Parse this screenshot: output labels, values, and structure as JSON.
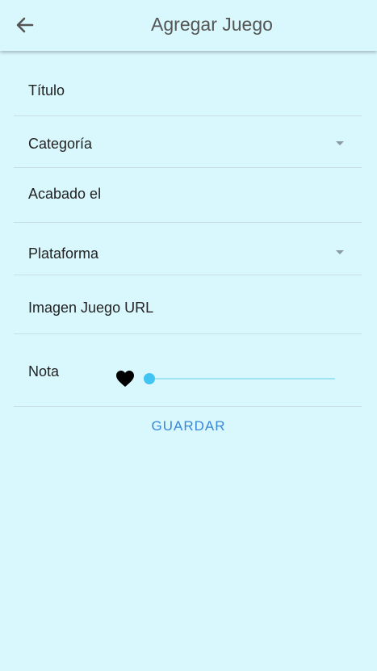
{
  "appbar": {
    "title": "Agregar Juego",
    "back_icon": "arrow-left-icon"
  },
  "form": {
    "titulo_label": "Título",
    "categoria_label": "Categoría",
    "acabado_label": "Acabado el",
    "plataforma_label": "Plataforma",
    "imagen_label": "Imagen Juego URL",
    "nota_label": "Nota",
    "nota_value": 0,
    "save_label": "GUARDAR"
  },
  "colors": {
    "background": "#d9f8fd",
    "accent": "#42c4f2",
    "button_text": "#3a86d8"
  }
}
